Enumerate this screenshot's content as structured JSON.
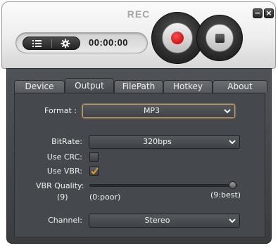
{
  "window": {
    "title": "REC",
    "minimize_glyph": "−",
    "close_glyph": "×"
  },
  "controls": {
    "list_icon": "list-icon",
    "settings_icon": "gear-icon",
    "timer": "00:00:00",
    "record_icon": "record-dot-icon",
    "stop_icon": "stop-square-icon",
    "record_color": "#d40000"
  },
  "tabs": [
    {
      "label": "Device",
      "active": false
    },
    {
      "label": "Output",
      "active": true
    },
    {
      "label": "FilePath",
      "active": false
    },
    {
      "label": "Hotkey",
      "active": false
    },
    {
      "label": "About",
      "active": false
    }
  ],
  "output": {
    "format_label": "Format :",
    "format_value": "MP3",
    "bitrate_label": "BitRate:",
    "bitrate_value": "320bps",
    "use_crc_label": "Use CRC:",
    "use_crc_checked": false,
    "use_vbr_label": "Use VBR:",
    "use_vbr_checked": true,
    "vbr_quality_label": "VBR Quality:",
    "vbr_quality_value": "(9)",
    "vbr_min_label": "(0:poor)",
    "vbr_max_label": "(9:best)",
    "vbr_level": 9,
    "vbr_level_max": 9,
    "channel_label": "Channel:",
    "channel_value": "Stereo"
  },
  "colors": {
    "accent_focus": "#c8a060",
    "checkmark": "#e0a020"
  }
}
